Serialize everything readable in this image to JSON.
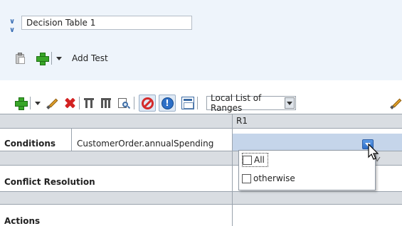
{
  "header": {
    "title_value": "Decision Table 1"
  },
  "toolbar_top": {
    "add_test_label": "Add Test"
  },
  "toolbar_main": {
    "range_select_value": "Local List of Ranges"
  },
  "table": {
    "column_header": "R1",
    "conditions_label": "Conditions",
    "condition_expression": "CustomerOrder.annualSpending",
    "conflict_label": "Conflict Resolution",
    "actions_label": "Actions"
  },
  "popup": {
    "items": [
      "All",
      "otherwise"
    ]
  },
  "colors": {
    "header_bg": "#eef4fb",
    "selected_cell": "#c5d5ea",
    "accent_blue": "#2f6fc9"
  }
}
